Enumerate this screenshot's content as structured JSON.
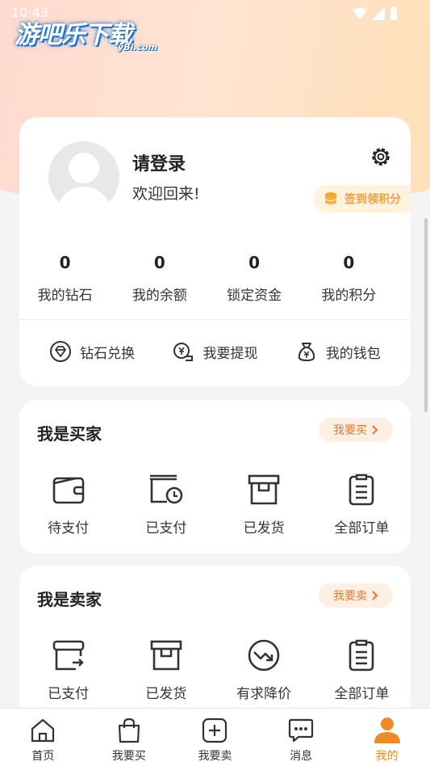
{
  "status_bar": {
    "time": "10:43"
  },
  "watermark": {
    "title": "游吧乐下载",
    "subtitle": "yBl.com"
  },
  "profile": {
    "login_title": "请登录",
    "welcome": "欢迎回来!",
    "checkin_label": "签到领积分",
    "stats": [
      {
        "value": "0",
        "label": "我的钻石"
      },
      {
        "value": "0",
        "label": "我的余额"
      },
      {
        "value": "0",
        "label": "锁定资金"
      },
      {
        "value": "0",
        "label": "我的积分"
      }
    ],
    "actions": [
      {
        "label": "钻石兑换",
        "icon": "diamond-icon"
      },
      {
        "label": "我要提现",
        "icon": "withdraw-icon"
      },
      {
        "label": "我的钱包",
        "icon": "wallet-bag-icon"
      }
    ]
  },
  "buyer": {
    "title": "我是买家",
    "pill": "我要买",
    "items": [
      {
        "label": "待支付",
        "icon": "wallet-icon"
      },
      {
        "label": "已支付",
        "icon": "paid-clock-icon"
      },
      {
        "label": "已发货",
        "icon": "box-icon"
      },
      {
        "label": "全部订单",
        "icon": "order-list-icon"
      }
    ]
  },
  "seller": {
    "title": "我是卖家",
    "pill": "我要卖",
    "items": [
      {
        "label": "已支付",
        "icon": "box-out-icon"
      },
      {
        "label": "已发货",
        "icon": "box-icon"
      },
      {
        "label": "有求降价",
        "icon": "price-down-icon"
      },
      {
        "label": "全部订单",
        "icon": "order-list-icon"
      }
    ]
  },
  "nav": {
    "items": [
      {
        "label": "首页",
        "icon": "home-icon"
      },
      {
        "label": "我要买",
        "icon": "shopping-bag-icon"
      },
      {
        "label": "我要卖",
        "icon": "plus-box-icon"
      },
      {
        "label": "消息",
        "icon": "message-icon"
      },
      {
        "label": "我的",
        "icon": "user-icon"
      }
    ],
    "active_index": 4
  },
  "colors": {
    "accent": "#f08a24",
    "pill_text": "#e9792c",
    "checkin_text": "#f2a13a"
  }
}
